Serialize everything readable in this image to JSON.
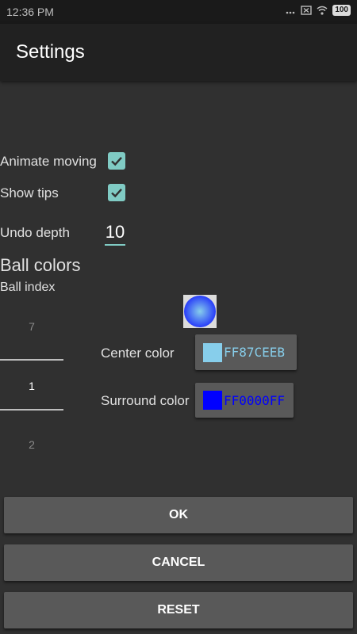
{
  "status_bar": {
    "time": "12:36 PM",
    "icons": [
      "dots-icon",
      "close-box-icon",
      "wifi-icon"
    ],
    "battery": "100"
  },
  "app_bar": {
    "title": "Settings"
  },
  "settings": {
    "animate_moving": {
      "label": "Animate moving",
      "checked": true
    },
    "show_tips": {
      "label": "Show tips",
      "checked": true
    },
    "undo_depth": {
      "label": "Undo depth",
      "value": "10"
    }
  },
  "ball_colors": {
    "title": "Ball colors",
    "index_label": "Ball index",
    "picker": {
      "prev": "7",
      "current": "1",
      "next": "2"
    },
    "center": {
      "label": "Center color",
      "hex": "FF87CEEB",
      "color": "#87ceeb"
    },
    "surround": {
      "label": "Surround color",
      "hex": "FF0000FF",
      "color": "#0000ff"
    }
  },
  "buttons": {
    "ok": "OK",
    "cancel": "CANCEL",
    "reset": "RESET"
  },
  "colors": {
    "accent": "#80cbc4",
    "background": "#303030",
    "app_bar": "#212121",
    "button": "#595959"
  }
}
